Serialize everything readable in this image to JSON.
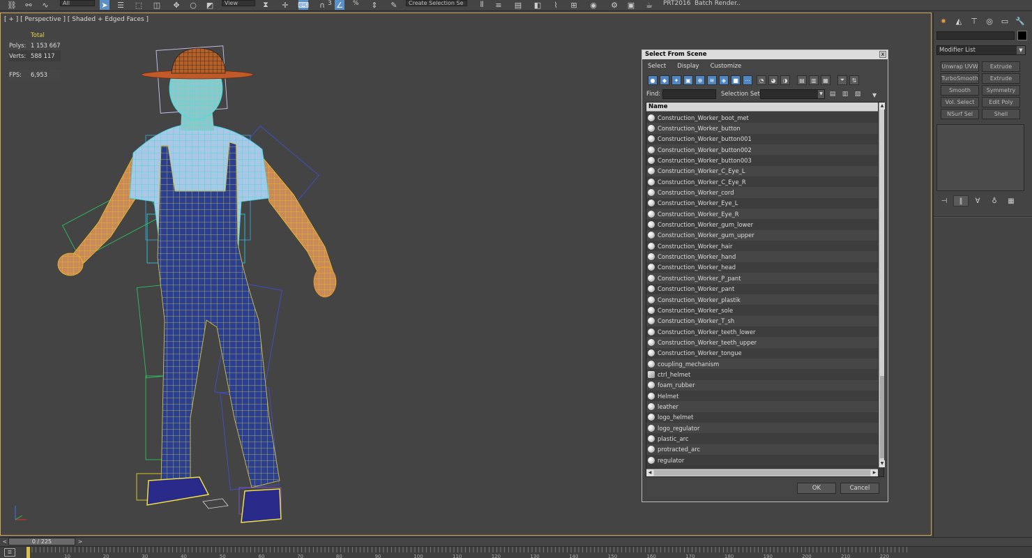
{
  "toolbar": {
    "filter_combo": "All",
    "view_combo": "View",
    "selection_set_combo": "Create Selection Se",
    "percent_snap": "%",
    "number_label": "3",
    "render_preset": "PRT2016",
    "batch_render": "Batch Render.."
  },
  "viewport": {
    "label": "[ + ] [ Perspective ] [ Shaded + Edged Faces ]",
    "stats": {
      "header": "Total",
      "polys_label": "Polys:",
      "polys_value": "1 153 667",
      "verts_label": "Verts:",
      "verts_value": "588 117",
      "fps_label": "FPS:",
      "fps_value": "6,953"
    }
  },
  "command_panel": {
    "modifier_list": "Modifier List",
    "modifier_buttons": [
      "Unwrap UVW",
      "Extrude",
      "TurboSmooth",
      "Extrude",
      "Smooth",
      "Symmetry",
      "Vol. Select",
      "Edit Poly",
      "NSurf Sel",
      "Shell"
    ]
  },
  "dialog": {
    "title": "Select From Scene",
    "close": "x",
    "menu": [
      "Select",
      "Display",
      "Customize"
    ],
    "find_label": "Find:",
    "find_value": "",
    "selection_set_label": "Selection Set:",
    "column_name": "Name",
    "objects": [
      "Construction_Worker_boot_met",
      "Construction_Worker_button",
      "Construction_Worker_button001",
      "Construction_Worker_button002",
      "Construction_Worker_button003",
      "Construction_Worker_C_Eye_L",
      "Construction_Worker_C_Eye_R",
      "Construction_Worker_cord",
      "Construction_Worker_Eye_L",
      "Construction_Worker_Eye_R",
      "Construction_Worker_gum_lower",
      "Construction_Worker_gum_upper",
      "Construction_Worker_hair",
      "Construction_Worker_hand",
      "Construction_Worker_head",
      "Construction_Worker_P_pant",
      "Construction_Worker_pant",
      "Construction_Worker_plastik",
      "Construction_Worker_sole",
      "Construction_Worker_T_sh",
      "Construction_Worker_teeth_lower",
      "Construction_Worker_teeth_upper",
      "Construction_Worker_tongue",
      "coupling_mechanism",
      "ctrl_helmet",
      "foam_rubber",
      "Helmet",
      "leather",
      "logo_helmet",
      "logo_regulator",
      "plastic_arc",
      "protracted_arc",
      "regulator"
    ],
    "ok": "OK",
    "cancel": "Cancel"
  },
  "timeline": {
    "slider_label": "0 / 225",
    "prev": "<",
    "next": ">",
    "ticks": [
      "10",
      "20",
      "30",
      "40",
      "50",
      "60",
      "70",
      "80",
      "90",
      "100",
      "110",
      "120",
      "130",
      "140",
      "150",
      "160",
      "170",
      "180",
      "190",
      "200",
      "210",
      "220"
    ]
  }
}
